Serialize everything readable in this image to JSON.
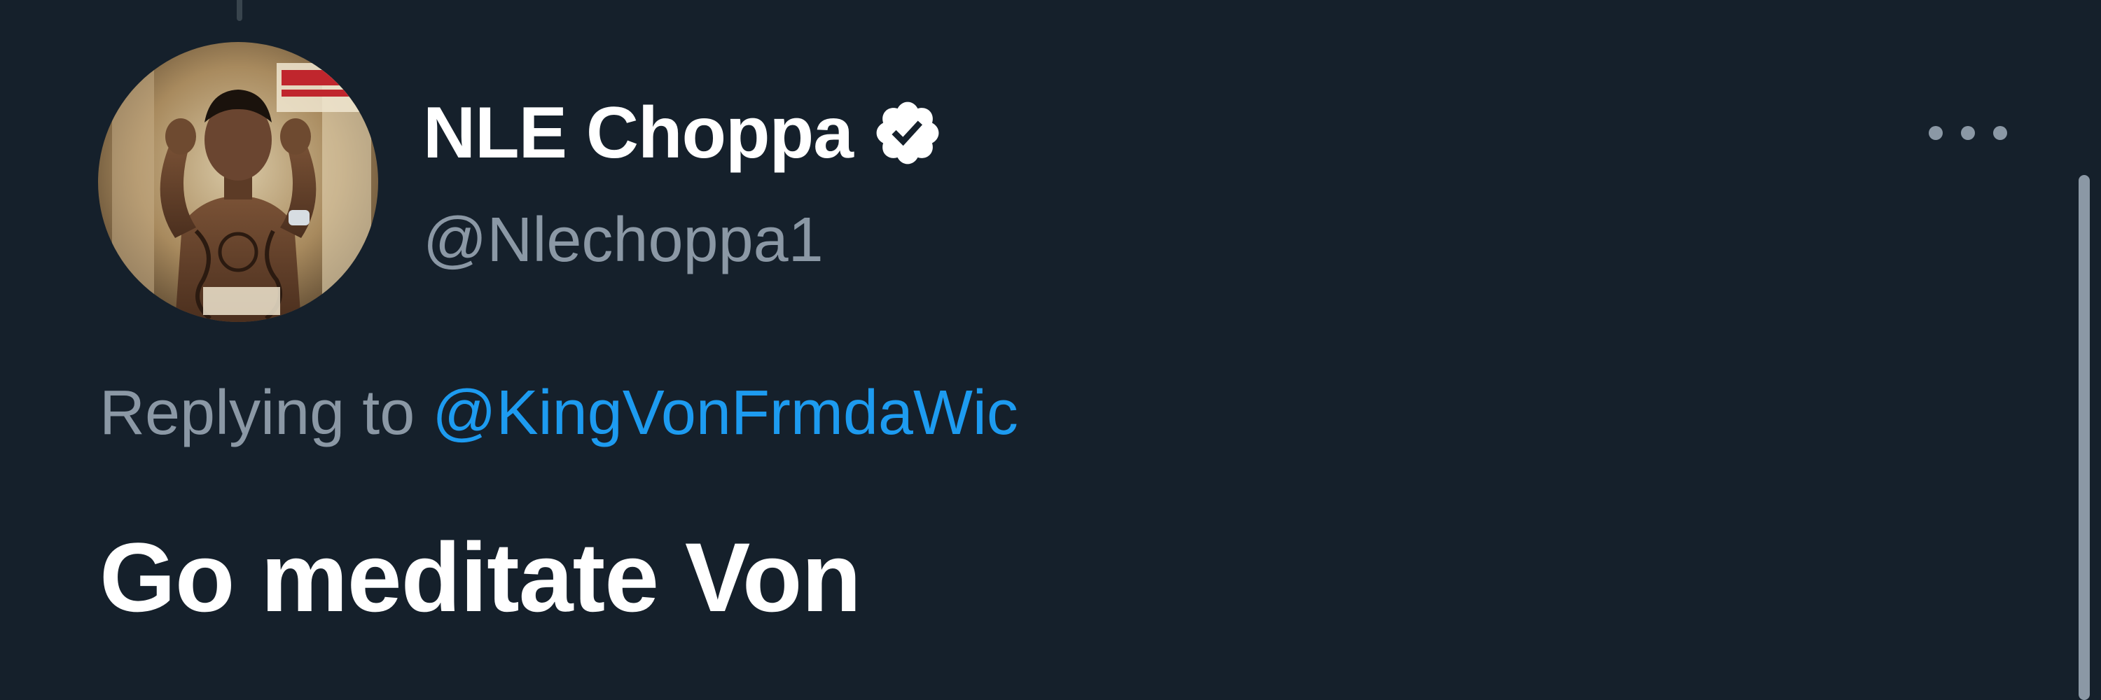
{
  "tweet": {
    "author": {
      "display_name": "NLE Choppa",
      "handle": "@Nlechoppa1",
      "verified": true,
      "avatar_icon": "avatar-photo"
    },
    "reply": {
      "prefix": "Replying to ",
      "mention": "@KingVonFrmdaWic"
    },
    "text": "Go meditate Von",
    "menu_icon": "more-options-icon"
  },
  "colors": {
    "background": "#15202b",
    "primary_text": "#ffffff",
    "secondary_text": "#8b98a5",
    "link": "#1d9bf0"
  }
}
